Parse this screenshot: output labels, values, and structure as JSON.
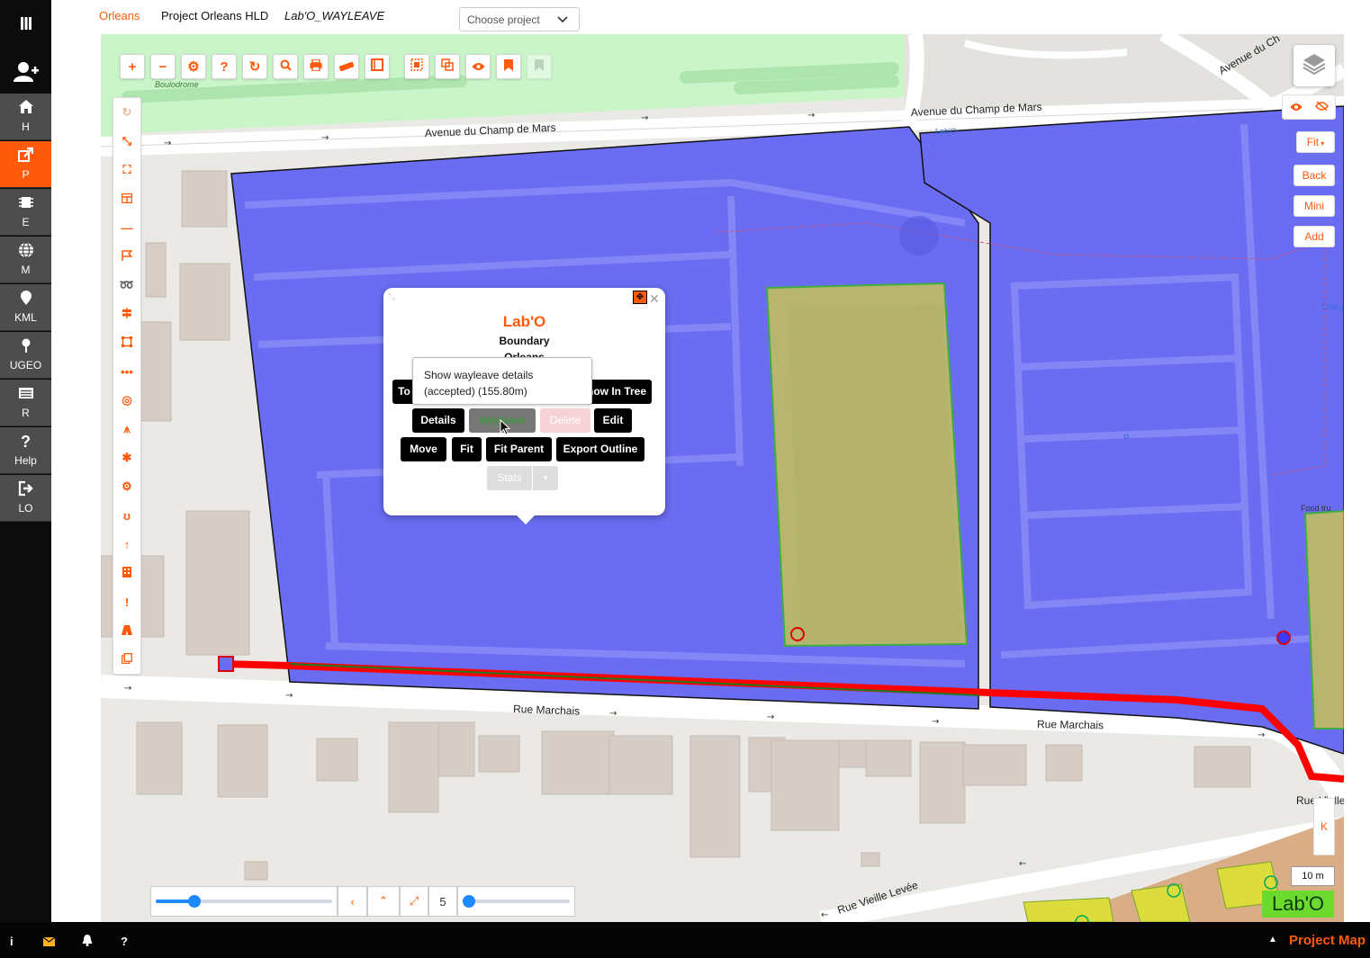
{
  "sidebar": {
    "items": [
      {
        "label": "H",
        "icon": "home-icon"
      },
      {
        "label": "P",
        "icon": "share-icon"
      },
      {
        "label": "E",
        "icon": "chip-icon"
      },
      {
        "label": "M",
        "icon": "globe-icon"
      },
      {
        "label": "KML",
        "icon": "map-pin-icon"
      },
      {
        "label": "UGEO",
        "icon": "location-icon"
      },
      {
        "label": "R",
        "icon": "list-icon"
      },
      {
        "label": "Help",
        "icon": "question-icon"
      },
      {
        "label": "LO",
        "icon": "logout-icon"
      }
    ],
    "active": "P"
  },
  "header": {
    "org": "Orleans",
    "project": "Project Orleans HLD",
    "layer": "Lab'O_WAYLEAVE",
    "project_select": "Choose project"
  },
  "map": {
    "streets": {
      "champ_de_mars_left": "Avenue du Champ de Mars",
      "champ_de_mars_right": "Avenue du Champ de Mars",
      "avenue_du_ch": "Avenue du Ch",
      "marchais_left": "Rue Marchais",
      "marchais_right": "Rue Marchais",
      "vieille_levee": "Rue Vieille Levée",
      "rue_vielle": "Rue Vielle"
    },
    "poi": {
      "boulodrome": "Boulodrome",
      "labo": "Lab'O",
      "charge": "ChargeP",
      "food": "Food tru",
      "parking": "P"
    }
  },
  "popup": {
    "title": "Lab'O",
    "subtitle": "Boundary",
    "subtitle2": "Orleans",
    "row1": [
      "To",
      "Show In Tree"
    ],
    "row2": [
      "Details",
      "Wayleave",
      "Delete",
      "Edit"
    ],
    "row3": [
      "Move",
      "Fit",
      "Fit Parent",
      "Export Outline"
    ],
    "stats": "Stats",
    "tooltip_line1": "Show wayleave details",
    "tooltip_line2": "(accepted) (155.80m)"
  },
  "right_controls": {
    "fit": "Fit",
    "back": "Back",
    "mini": "Mini",
    "add": "Add",
    "k": "K",
    "scale": "10 m",
    "badge": "Lab'O"
  },
  "bottom_controls": {
    "zoom_value": "5",
    "slider1_fraction": 0.22,
    "slider2_fraction": 0.05
  },
  "footer": {
    "title": "Project Map"
  },
  "colors": {
    "accent": "#ff5a0a",
    "boundary_fill": "#6a6cf2",
    "wayleave_red": "#ff0000",
    "olive": "#b7b56f"
  }
}
